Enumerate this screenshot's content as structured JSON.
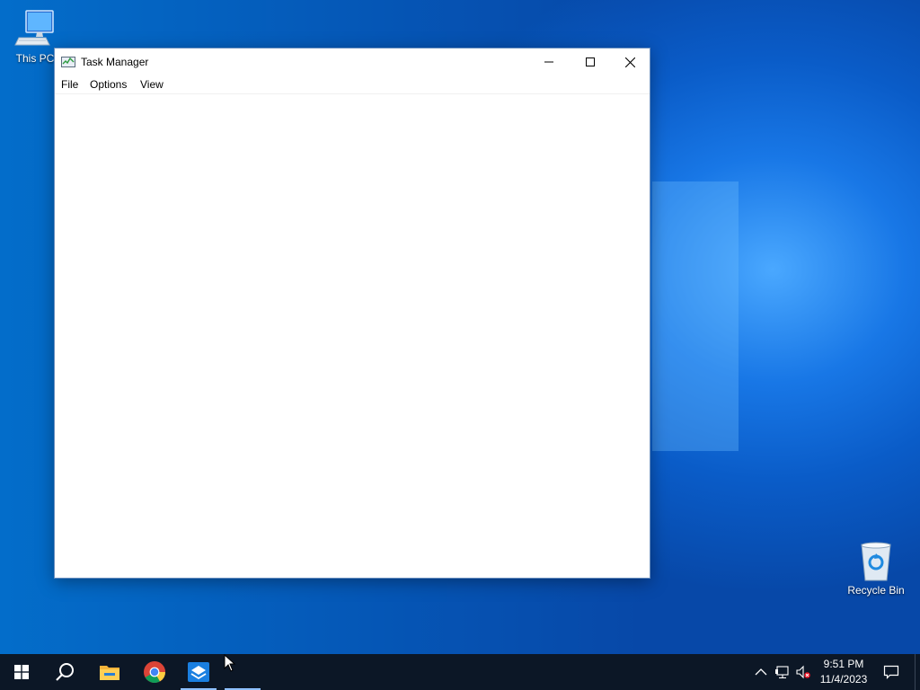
{
  "desktop": {
    "icons": [
      {
        "label": "This PC",
        "icon": "computer-icon"
      },
      {
        "label": "Recycle Bin",
        "icon": "recycle-bin-icon"
      }
    ]
  },
  "window": {
    "title": "Task Manager",
    "icon": "task-manager-icon",
    "controls": [
      "minimize-icon",
      "maximize-icon",
      "close-icon"
    ],
    "menu": [
      "File",
      "Options",
      "View"
    ]
  },
  "taskbar": {
    "apps": [
      "start-icon",
      "search-icon",
      "file-explorer-icon",
      "chrome-icon",
      "task-manager-app-icon"
    ],
    "tray": {
      "icons": [
        "chevron-up-icon",
        "network-icon",
        "volume-muted-icon",
        "action-center-icon"
      ],
      "time": "9:51 PM",
      "date": "11/4/2023"
    }
  },
  "colors": {
    "accent": "#0078d7",
    "taskbar": "#0c1726",
    "active_indicator": "#8ec0ff"
  }
}
